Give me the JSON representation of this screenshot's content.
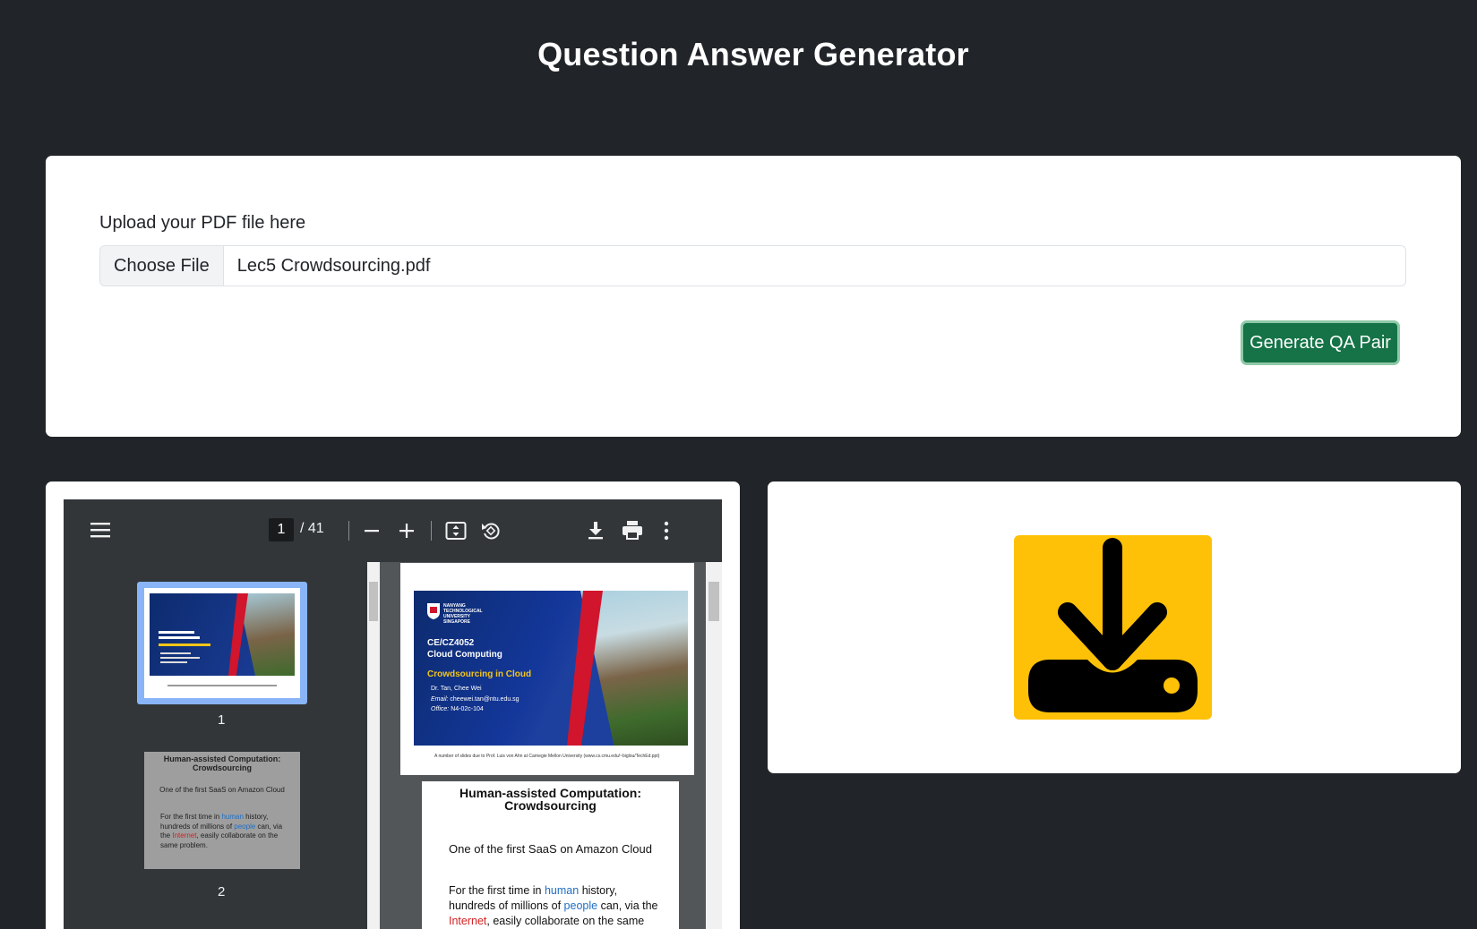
{
  "header": {
    "title": "Question Answer Generator"
  },
  "upload": {
    "label": "Upload your PDF file here",
    "choose_label": "Choose File",
    "file_name": "Lec5 Crowdsourcing.pdf",
    "generate_label": "Generate QA Pair"
  },
  "viewer": {
    "current_page": "1",
    "total_pages": "/ 41",
    "toolbar_icons": [
      "menu-icon",
      "zoom-out-icon",
      "zoom-in-icon",
      "fit-page-icon",
      "rotate-icon",
      "download-icon",
      "print-icon",
      "more-icon"
    ],
    "thumbnails": [
      {
        "number": "1"
      },
      {
        "number": "2"
      }
    ],
    "slide1": {
      "university": "NANYANG TECHNOLOGICAL UNIVERSITY SINGAPORE",
      "course_code": "CE/CZ4052",
      "course_name": "Cloud Computing",
      "topic": "Crowdsourcing in Cloud",
      "author": "Dr. Tan, Chee Wei",
      "email_label": "Email:",
      "email": "cheewei.tan@ntu.edu.sg",
      "office_label": "Office:",
      "office": "N4-02c-104",
      "caption": "A number of slides due to Prof. Luis von Ahn at Carnegie Mellon University (www.cs.cmu.edu/~biglou/TechEd.ppt)"
    },
    "slide2": {
      "title_line1": "Human-assisted Computation:",
      "title_line2": "Crowdsourcing",
      "subtitle": "One of the first SaaS on Amazon Cloud",
      "body_pre": "For the first time in ",
      "body_w1": "human",
      "body_mid1": " history, hundreds of millions of ",
      "body_w2": "people",
      "body_mid2": " can, via the ",
      "body_w3": "Internet",
      "body_post": ", easily collaborate on the same problem."
    }
  },
  "download": {
    "icon": "download-icon",
    "accent_color": "#FFC107"
  },
  "colors": {
    "background": "#212529",
    "primary_button": "#157347"
  }
}
